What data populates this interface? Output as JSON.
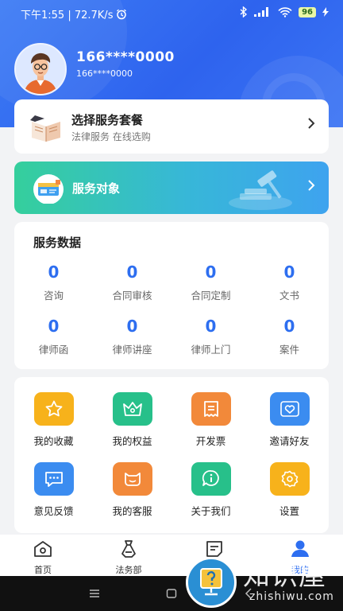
{
  "status_bar": {
    "time_speed": "下午1:55 | 72.7K/s",
    "battery": "96"
  },
  "profile": {
    "name": "166****0000",
    "phone": "166****0000"
  },
  "package_card": {
    "title": "选择服务套餐",
    "subtitle": "法律服务 在线选购"
  },
  "service_target": {
    "title": "服务对象"
  },
  "stats": {
    "title": "服务数据",
    "items": [
      {
        "value": "0",
        "label": "咨询"
      },
      {
        "value": "0",
        "label": "合同审核"
      },
      {
        "value": "0",
        "label": "合同定制"
      },
      {
        "value": "0",
        "label": "文书"
      },
      {
        "value": "0",
        "label": "律师函"
      },
      {
        "value": "0",
        "label": "律师讲座"
      },
      {
        "value": "0",
        "label": "律师上门"
      },
      {
        "value": "0",
        "label": "案件"
      }
    ]
  },
  "grid": {
    "items": [
      {
        "label": "我的收藏",
        "icon": "star-icon",
        "color": "#f7b21b"
      },
      {
        "label": "我的权益",
        "icon": "crown-icon",
        "color": "#27c08a"
      },
      {
        "label": "开发票",
        "icon": "invoice-icon",
        "color": "#f2893a"
      },
      {
        "label": "邀请好友",
        "icon": "heart-icon",
        "color": "#3b8cf0"
      },
      {
        "label": "意见反馈",
        "icon": "chat-icon",
        "color": "#3b8cf0"
      },
      {
        "label": "我的客服",
        "icon": "service-icon",
        "color": "#f2893a"
      },
      {
        "label": "关于我们",
        "icon": "info-icon",
        "color": "#27c08a"
      },
      {
        "label": "设置",
        "icon": "gear-icon",
        "color": "#f7b21b"
      }
    ]
  },
  "tabbar": {
    "items": [
      {
        "label": "首页",
        "icon": "home-icon"
      },
      {
        "label": "法务部",
        "icon": "department-icon"
      },
      {
        "label": "",
        "icon": "document-icon"
      },
      {
        "label": "我的",
        "icon": "profile-icon",
        "active": true
      }
    ],
    "active_color": "#2d6ef0"
  },
  "watermark": {
    "title": "知识屋",
    "registered": "®",
    "domain": "zhishiwu.com"
  }
}
